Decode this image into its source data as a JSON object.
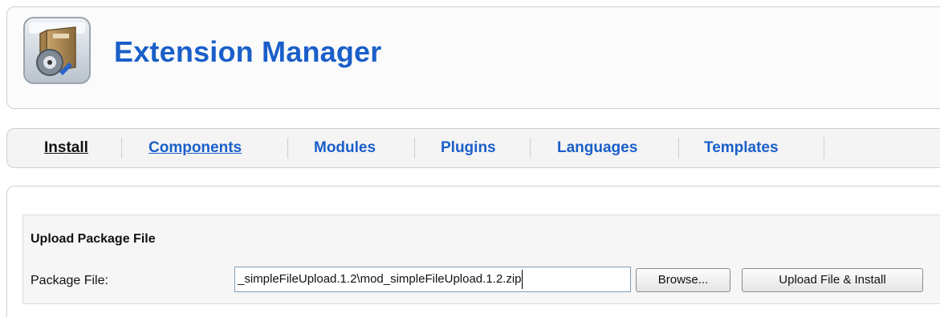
{
  "header": {
    "title": "Extension Manager",
    "logo_icon": "package-box-icon"
  },
  "tabs": [
    {
      "label": "Install",
      "state": "active"
    },
    {
      "label": "Components",
      "state": "link"
    },
    {
      "label": "Modules",
      "state": "normal"
    },
    {
      "label": "Plugins",
      "state": "normal"
    },
    {
      "label": "Languages",
      "state": "normal"
    },
    {
      "label": "Templates",
      "state": "normal"
    }
  ],
  "upload": {
    "section_title": "Upload Package File",
    "field_label": "Package File:",
    "file_value": "_simpleFileUpload.1.2\\mod_simpleFileUpload.1.2.zip",
    "browse_label": "Browse...",
    "submit_label": "Upload File & Install"
  },
  "colors": {
    "title": "#1a5fc9",
    "link": "#1a5fc9",
    "active_tab": "#111111"
  }
}
